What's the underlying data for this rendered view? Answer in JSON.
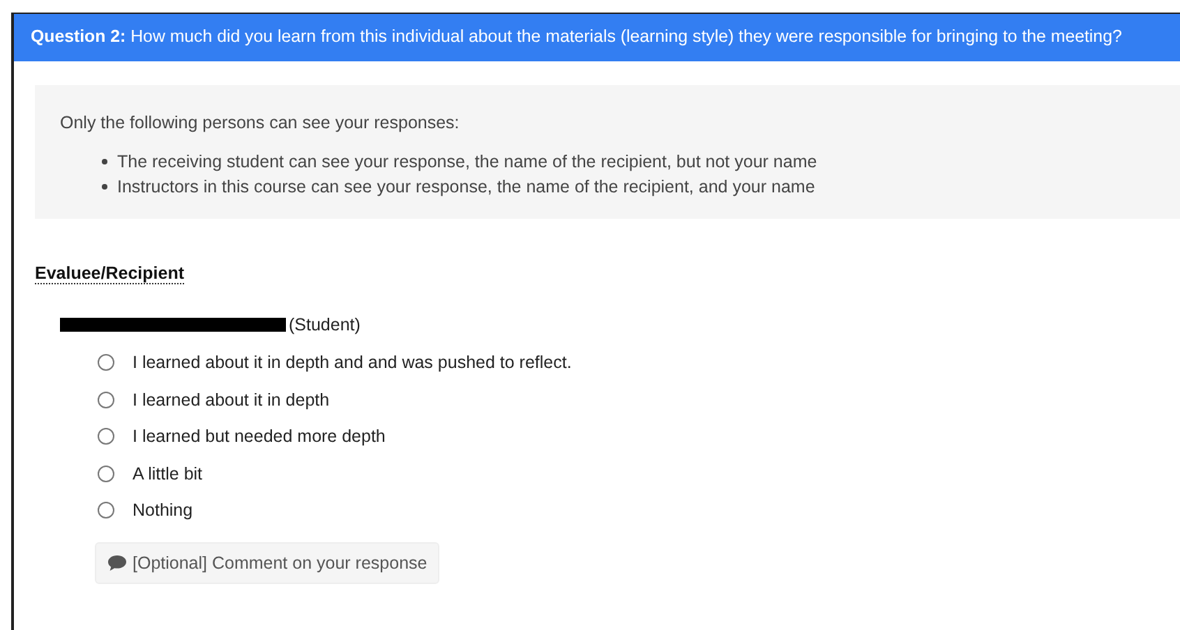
{
  "question": {
    "label": "Question 2:",
    "text": "How much did you learn from this individual about the materials (learning style) they were responsible for bringing to the meeting?"
  },
  "visibility": {
    "intro": "Only the following persons can see your responses:",
    "items": [
      "The receiving student can see your response, the name of the recipient, but not your name",
      "Instructors in this course can see your response, the name of the recipient, and your name"
    ]
  },
  "evaluee_heading": "Evaluee/Recipient",
  "recipient": {
    "name_redacted": true,
    "role": "(Student)"
  },
  "options": [
    {
      "label": "I learned about it in depth and and was pushed to reflect.",
      "selected": false
    },
    {
      "label": "I learned about it in depth",
      "selected": false
    },
    {
      "label": "I learned but needed more depth",
      "selected": false
    },
    {
      "label": "A little bit",
      "selected": false
    },
    {
      "label": "Nothing",
      "selected": false
    }
  ],
  "comment_button": "[Optional] Comment on your response"
}
